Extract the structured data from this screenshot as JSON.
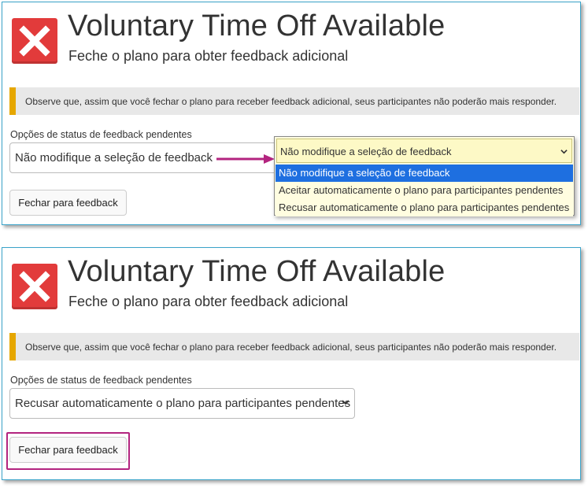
{
  "top": {
    "title": "Voluntary Time Off Available",
    "subtitle": "Feche o plano para obter feedback adicional",
    "notice": "Observe que, assim que você fechar o plano para receber feedback adicional, seus participantes não poderão mais responder.",
    "status_label": "Opções de status de feedback pendentes",
    "select_value": "Não modifique a seleção de feedback",
    "close_button": "Fechar para feedback",
    "dropdown": {
      "selected": "Não modifique a seleção de feedback",
      "options": [
        "Não modifique a seleção de feedback",
        "Aceitar automaticamente o plano para participantes pendentes",
        "Recusar automaticamente o plano para participantes pendentes"
      ],
      "highlighted_index": 0
    }
  },
  "bottom": {
    "title": "Voluntary Time Off Available",
    "subtitle": "Feche o plano para obter feedback adicional",
    "notice": "Observe que, assim que você fechar o plano para receber feedback adicional, seus participantes não poderão mais responder.",
    "status_label": "Opções de status de feedback pendentes",
    "select_value": "Recusar automaticamente o plano para participantes pendentes",
    "close_button": "Fechar para feedback"
  },
  "icons": {
    "status": "close-x-icon",
    "select_chevron": "chevron-down-icon",
    "annotation_arrow": "arrow-right-icon"
  },
  "colors": {
    "error_red": "#e23b3b",
    "notice_accent": "#e6a700",
    "annotation_magenta": "#b3247f",
    "option_highlight": "#1e6fe0",
    "panel_border": "#3aa3c9"
  }
}
